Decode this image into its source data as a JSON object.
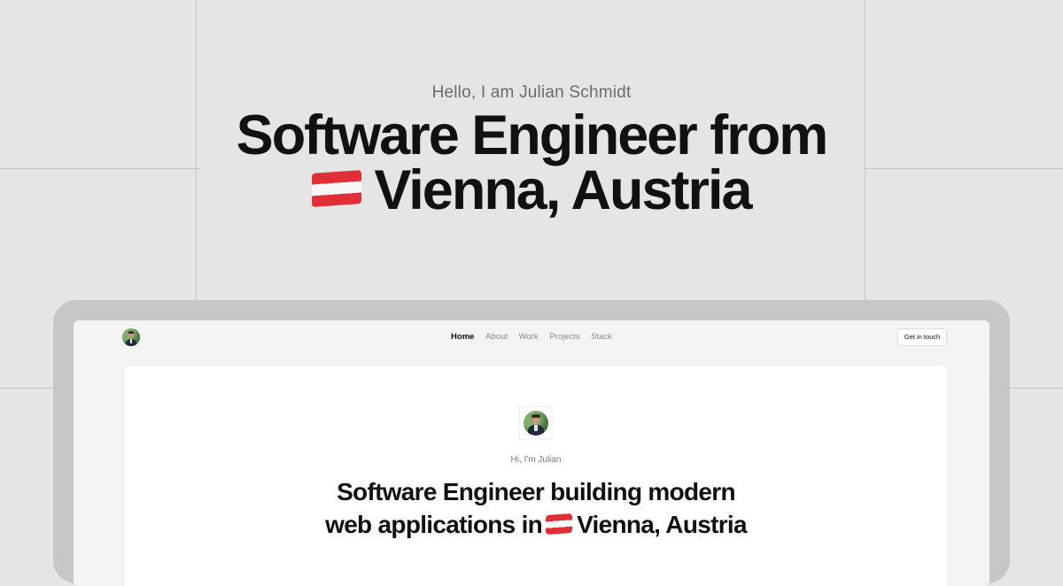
{
  "hero": {
    "greeting": "Hello, I am Julian Schmidt",
    "title_line1": "Software Engineer from",
    "title_line2": "Vienna, Austria"
  },
  "nav": {
    "items": [
      {
        "label": "Home",
        "active": true
      },
      {
        "label": "About",
        "active": false
      },
      {
        "label": "Work",
        "active": false
      },
      {
        "label": "Projects",
        "active": false
      },
      {
        "label": "Stack",
        "active": false
      }
    ],
    "cta_label": "Get in touch"
  },
  "card": {
    "greeting": "Hi, I'm Julian",
    "title_line1": "Software Engineer building modern",
    "title_line2_pre": "web applications in",
    "title_line2_post": "Vienna, Austria"
  },
  "icons": {
    "flag": "austria-flag-icon",
    "avatar": "profile-photo"
  },
  "colors": {
    "background": "#e5e5e5",
    "laptop_frame": "#c7c7c7",
    "flag_red": "#e12f38"
  }
}
